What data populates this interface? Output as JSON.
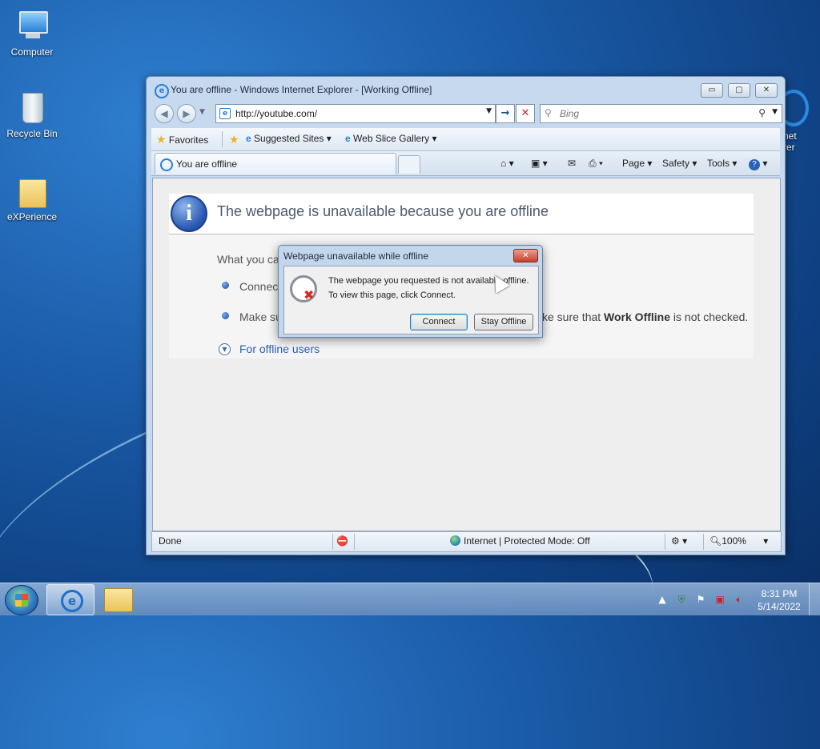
{
  "desktop": {
    "icons": [
      {
        "label": "Computer"
      },
      {
        "label": "Recycle Bin"
      },
      {
        "label": "eXPerience"
      }
    ],
    "partial_icon_text": [
      "net",
      "rer"
    ]
  },
  "window": {
    "title": "You are offline - Windows Internet Explorer - [Working Offline]",
    "buttons": {
      "minimize": "▭",
      "maximize": "▢",
      "close": "✕"
    },
    "address": {
      "value": "http://youtube.com/"
    },
    "search": {
      "placeholder": "Bing"
    },
    "favorites_bar": {
      "favorites_label": "Favorites",
      "suggested_sites_label": "Suggested Sites",
      "web_slice_label": "Web Slice Gallery"
    },
    "tab": {
      "label": "You are offline"
    },
    "command_bar": {
      "page": "Page",
      "safety": "Safety",
      "tools": "Tools"
    },
    "content": {
      "heading": "The webpage is unavailable because you are offline",
      "what_text": "What you ca",
      "bullet1": "Connect",
      "bullet2": "Make su",
      "bullet2_tail_prefix": "ke sure that ",
      "bullet2_tail_bold": "Work Offline",
      "bullet2_tail_suffix": " is not checked.",
      "offline_link": "For offline users"
    },
    "status": {
      "left": "Done",
      "zone": "Internet | Protected Mode: Off",
      "zoom": "100%"
    }
  },
  "dialog": {
    "title": "Webpage unavailable while offline",
    "message_line1": "The webpage you requested is not available offline.",
    "message_line2": "To view this page, click Connect.",
    "connect_label": "Connect",
    "stay_offline_label": "Stay Offline"
  },
  "taskbar": {
    "clock_time": "8:31 PM",
    "clock_date": "5/14/2022"
  },
  "colors": {
    "desktop": "#1a5aa6",
    "link": "#2d5fb0",
    "error_title": "#4b5b6e"
  }
}
